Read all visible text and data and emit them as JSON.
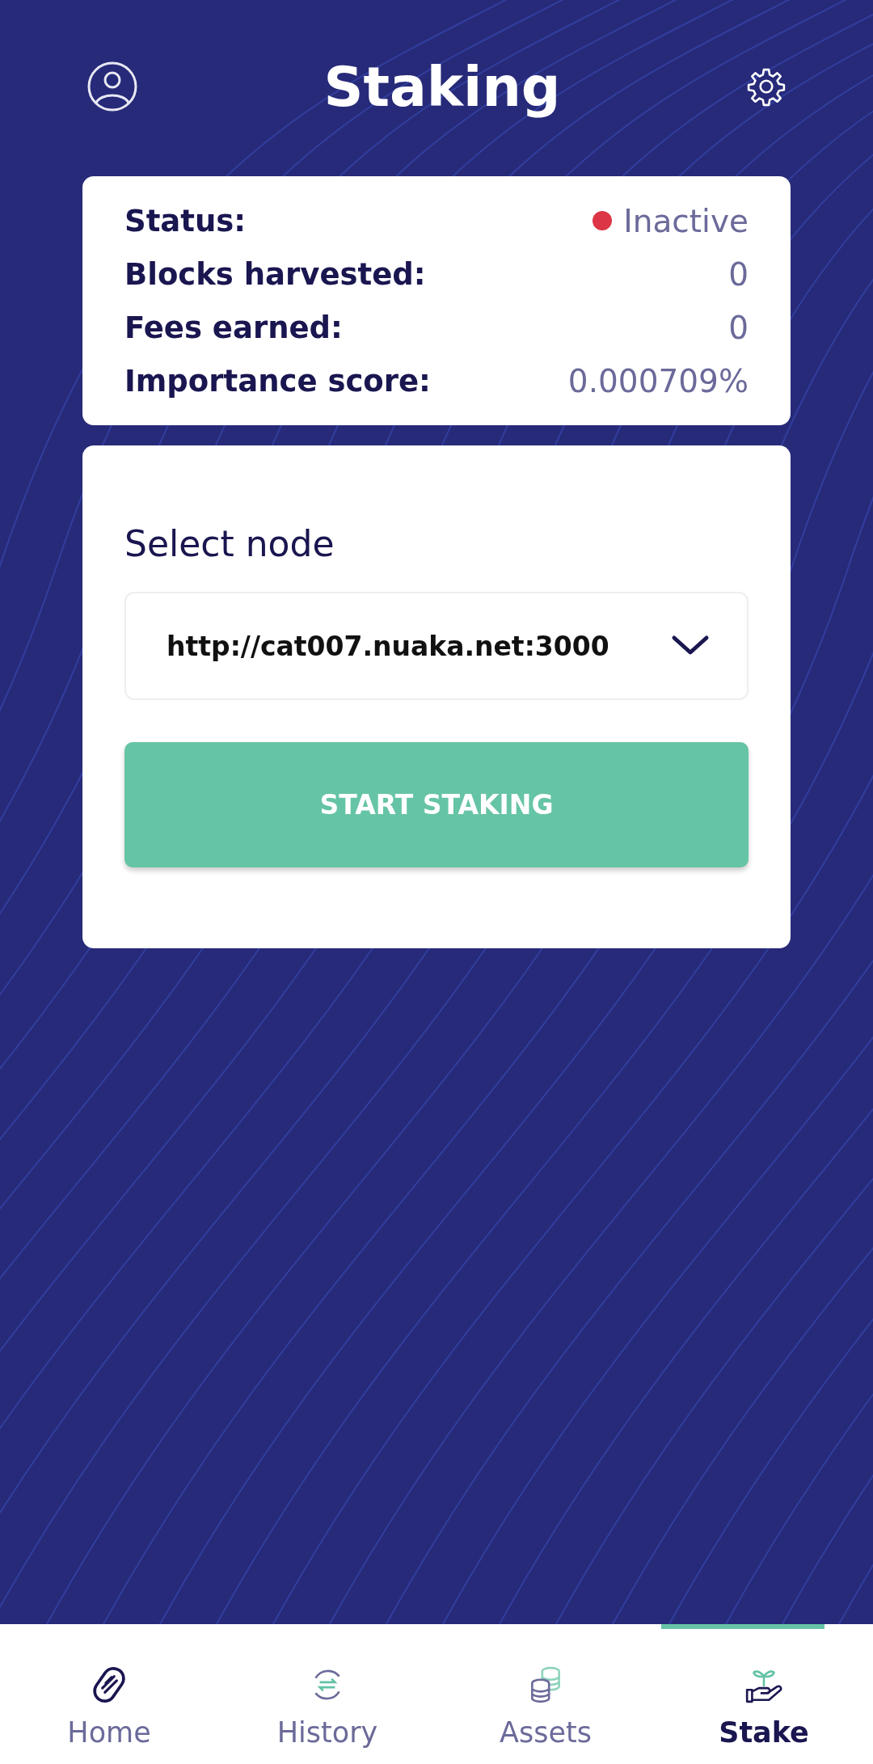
{
  "header": {
    "title": "Staking"
  },
  "stats": [
    {
      "label": "Status:",
      "value": "Inactive",
      "color": "#dc3545"
    },
    {
      "label": "Blocks harvested:",
      "value": "0"
    },
    {
      "label": "Fees earned:",
      "value": "0"
    },
    {
      "label": "Importance score:",
      "value": "0.000709%"
    }
  ],
  "node": {
    "label": "Select node",
    "value": "http://cat007.nuaka.net:3000",
    "button": "START STAKING"
  },
  "nav": [
    {
      "label": "Home",
      "kind": "home",
      "selected": false
    },
    {
      "label": "History",
      "kind": "history",
      "selected": false
    },
    {
      "label": "Assets",
      "kind": "assets",
      "selected": false
    },
    {
      "label": "Stake",
      "kind": "stake",
      "selected": true
    }
  ]
}
